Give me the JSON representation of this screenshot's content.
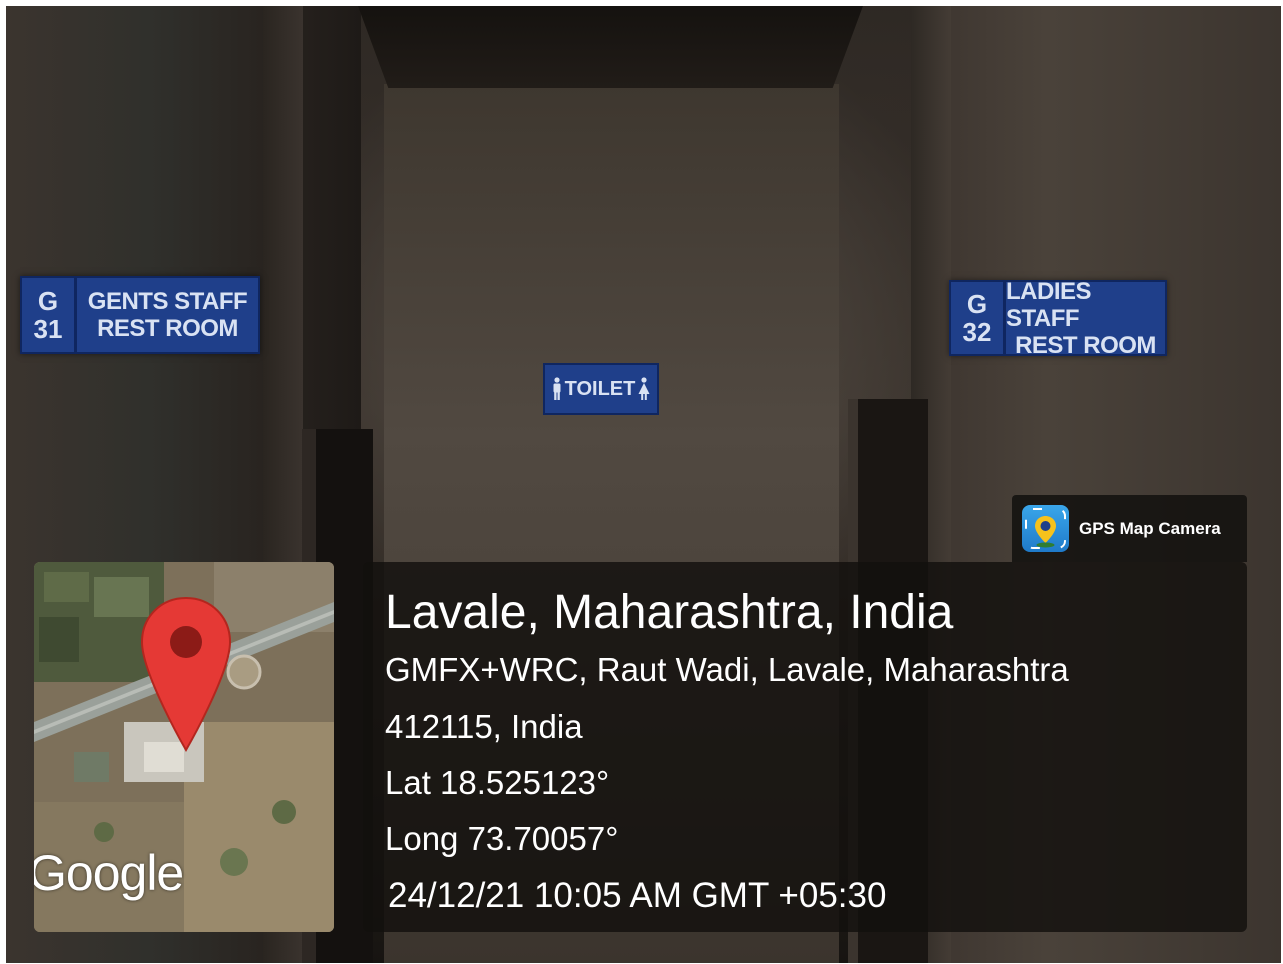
{
  "signs": {
    "gents": {
      "number_top": "G",
      "number_bottom": "31",
      "line1": "GENTS STAFF",
      "line2": "REST ROOM"
    },
    "ladies": {
      "number_top": "G",
      "number_bottom": "32",
      "line1": "LADIES STAFF",
      "line2": "REST ROOM"
    },
    "toilet": {
      "label": "TOILET"
    }
  },
  "overlay": {
    "brand": "GPS Map Camera",
    "map_logo": "Google",
    "place": "Lavale, Maharashtra, India",
    "address_line1": "GMFX+WRC, Raut Wadi, Lavale, Maharashtra",
    "address_line2": "412115, India",
    "latitude": "Lat 18.525123°",
    "longitude": "Long 73.70057°",
    "datetime": "24/12/21 10:05 AM GMT +05:30"
  },
  "colors": {
    "sign_blue": "#1f3f8a",
    "pin_red": "#e53935",
    "overlay_bg": "#121010"
  },
  "icons": {
    "map_pin": "map-pin-icon",
    "camera": "gps-camera-icon",
    "man": "man-icon",
    "woman": "woman-icon"
  }
}
